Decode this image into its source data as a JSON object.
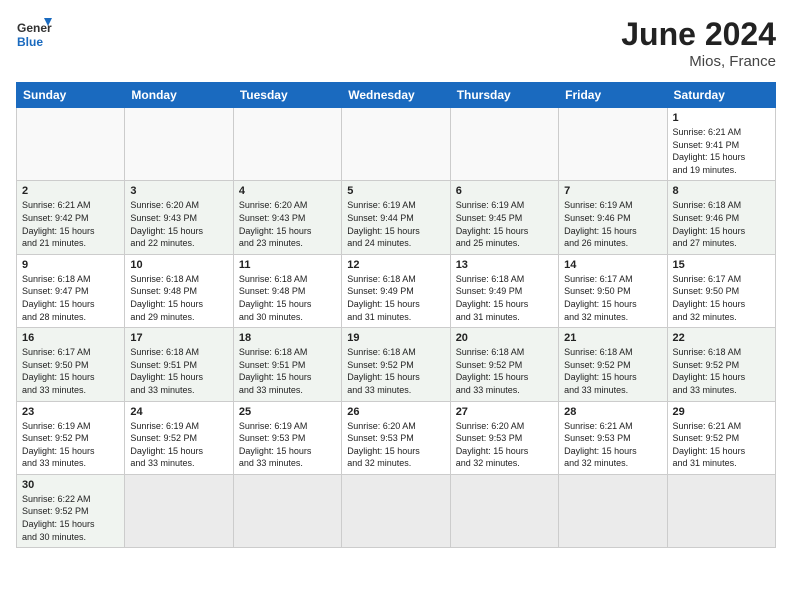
{
  "header": {
    "logo_general": "General",
    "logo_blue": "Blue",
    "month_title": "June 2024",
    "location": "Mios, France"
  },
  "days_of_week": [
    "Sunday",
    "Monday",
    "Tuesday",
    "Wednesday",
    "Thursday",
    "Friday",
    "Saturday"
  ],
  "weeks": [
    {
      "stripe": false,
      "days": [
        {
          "num": "",
          "info": ""
        },
        {
          "num": "",
          "info": ""
        },
        {
          "num": "",
          "info": ""
        },
        {
          "num": "",
          "info": ""
        },
        {
          "num": "",
          "info": ""
        },
        {
          "num": "",
          "info": ""
        },
        {
          "num": "1",
          "info": "Sunrise: 6:21 AM\nSunset: 9:41 PM\nDaylight: 15 hours\nand 19 minutes."
        }
      ]
    },
    {
      "stripe": true,
      "days": [
        {
          "num": "2",
          "info": "Sunrise: 6:21 AM\nSunset: 9:42 PM\nDaylight: 15 hours\nand 21 minutes."
        },
        {
          "num": "3",
          "info": "Sunrise: 6:20 AM\nSunset: 9:43 PM\nDaylight: 15 hours\nand 22 minutes."
        },
        {
          "num": "4",
          "info": "Sunrise: 6:20 AM\nSunset: 9:43 PM\nDaylight: 15 hours\nand 23 minutes."
        },
        {
          "num": "5",
          "info": "Sunrise: 6:19 AM\nSunset: 9:44 PM\nDaylight: 15 hours\nand 24 minutes."
        },
        {
          "num": "6",
          "info": "Sunrise: 6:19 AM\nSunset: 9:45 PM\nDaylight: 15 hours\nand 25 minutes."
        },
        {
          "num": "7",
          "info": "Sunrise: 6:19 AM\nSunset: 9:46 PM\nDaylight: 15 hours\nand 26 minutes."
        },
        {
          "num": "8",
          "info": "Sunrise: 6:18 AM\nSunset: 9:46 PM\nDaylight: 15 hours\nand 27 minutes."
        }
      ]
    },
    {
      "stripe": false,
      "days": [
        {
          "num": "9",
          "info": "Sunrise: 6:18 AM\nSunset: 9:47 PM\nDaylight: 15 hours\nand 28 minutes."
        },
        {
          "num": "10",
          "info": "Sunrise: 6:18 AM\nSunset: 9:48 PM\nDaylight: 15 hours\nand 29 minutes."
        },
        {
          "num": "11",
          "info": "Sunrise: 6:18 AM\nSunset: 9:48 PM\nDaylight: 15 hours\nand 30 minutes."
        },
        {
          "num": "12",
          "info": "Sunrise: 6:18 AM\nSunset: 9:49 PM\nDaylight: 15 hours\nand 31 minutes."
        },
        {
          "num": "13",
          "info": "Sunrise: 6:18 AM\nSunset: 9:49 PM\nDaylight: 15 hours\nand 31 minutes."
        },
        {
          "num": "14",
          "info": "Sunrise: 6:17 AM\nSunset: 9:50 PM\nDaylight: 15 hours\nand 32 minutes."
        },
        {
          "num": "15",
          "info": "Sunrise: 6:17 AM\nSunset: 9:50 PM\nDaylight: 15 hours\nand 32 minutes."
        }
      ]
    },
    {
      "stripe": true,
      "days": [
        {
          "num": "16",
          "info": "Sunrise: 6:17 AM\nSunset: 9:50 PM\nDaylight: 15 hours\nand 33 minutes."
        },
        {
          "num": "17",
          "info": "Sunrise: 6:18 AM\nSunset: 9:51 PM\nDaylight: 15 hours\nand 33 minutes."
        },
        {
          "num": "18",
          "info": "Sunrise: 6:18 AM\nSunset: 9:51 PM\nDaylight: 15 hours\nand 33 minutes."
        },
        {
          "num": "19",
          "info": "Sunrise: 6:18 AM\nSunset: 9:52 PM\nDaylight: 15 hours\nand 33 minutes."
        },
        {
          "num": "20",
          "info": "Sunrise: 6:18 AM\nSunset: 9:52 PM\nDaylight: 15 hours\nand 33 minutes."
        },
        {
          "num": "21",
          "info": "Sunrise: 6:18 AM\nSunset: 9:52 PM\nDaylight: 15 hours\nand 33 minutes."
        },
        {
          "num": "22",
          "info": "Sunrise: 6:18 AM\nSunset: 9:52 PM\nDaylight: 15 hours\nand 33 minutes."
        }
      ]
    },
    {
      "stripe": false,
      "days": [
        {
          "num": "23",
          "info": "Sunrise: 6:19 AM\nSunset: 9:52 PM\nDaylight: 15 hours\nand 33 minutes."
        },
        {
          "num": "24",
          "info": "Sunrise: 6:19 AM\nSunset: 9:52 PM\nDaylight: 15 hours\nand 33 minutes."
        },
        {
          "num": "25",
          "info": "Sunrise: 6:19 AM\nSunset: 9:53 PM\nDaylight: 15 hours\nand 33 minutes."
        },
        {
          "num": "26",
          "info": "Sunrise: 6:20 AM\nSunset: 9:53 PM\nDaylight: 15 hours\nand 32 minutes."
        },
        {
          "num": "27",
          "info": "Sunrise: 6:20 AM\nSunset: 9:53 PM\nDaylight: 15 hours\nand 32 minutes."
        },
        {
          "num": "28",
          "info": "Sunrise: 6:21 AM\nSunset: 9:53 PM\nDaylight: 15 hours\nand 32 minutes."
        },
        {
          "num": "29",
          "info": "Sunrise: 6:21 AM\nSunset: 9:52 PM\nDaylight: 15 hours\nand 31 minutes."
        }
      ]
    },
    {
      "stripe": true,
      "days": [
        {
          "num": "30",
          "info": "Sunrise: 6:22 AM\nSunset: 9:52 PM\nDaylight: 15 hours\nand 30 minutes."
        },
        {
          "num": "",
          "info": ""
        },
        {
          "num": "",
          "info": ""
        },
        {
          "num": "",
          "info": ""
        },
        {
          "num": "",
          "info": ""
        },
        {
          "num": "",
          "info": ""
        },
        {
          "num": "",
          "info": ""
        }
      ]
    }
  ]
}
